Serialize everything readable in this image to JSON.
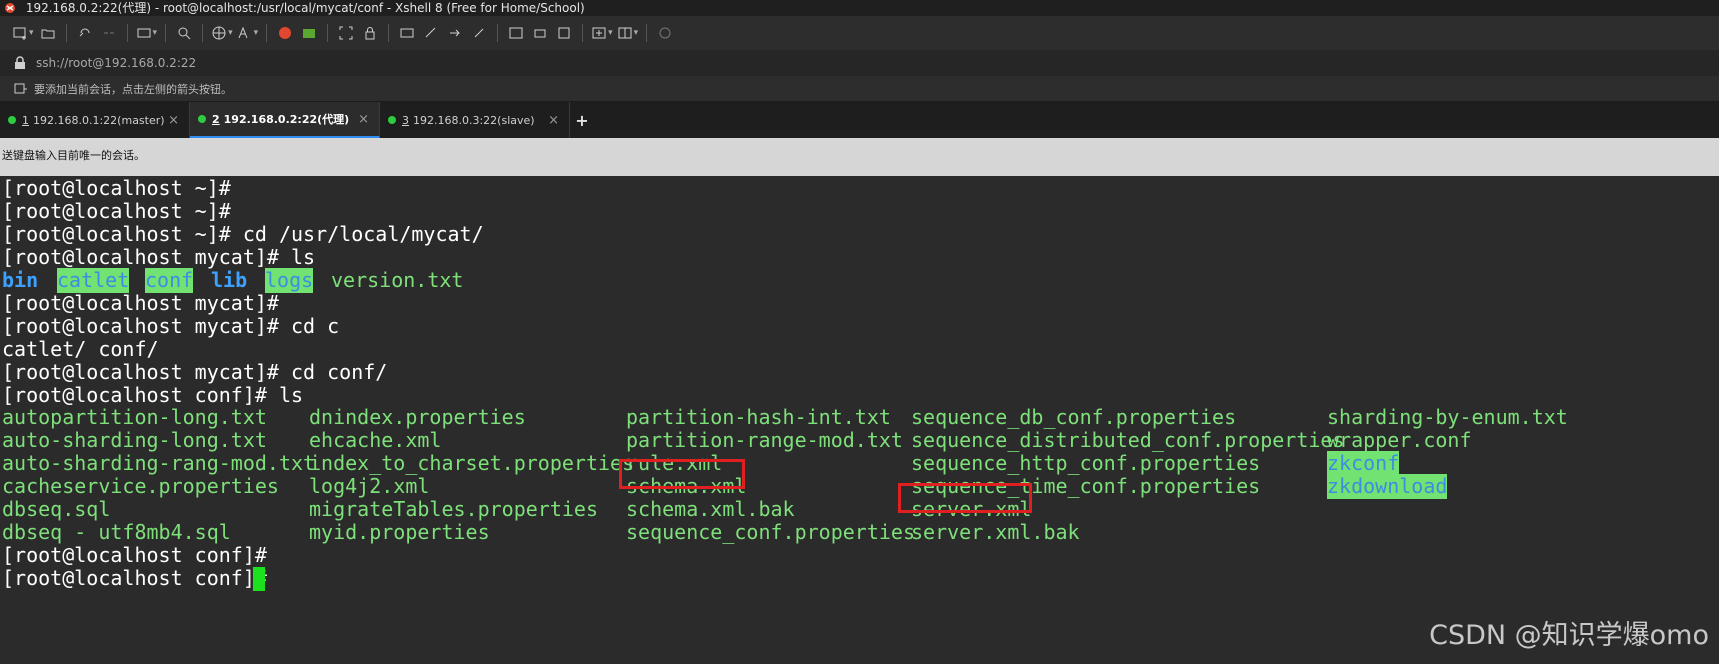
{
  "window": {
    "title": "192.168.0.2:22(代理) - root@localhost:/usr/local/mycat/conf - Xshell 8 (Free for Home/School)"
  },
  "address": {
    "url": "ssh://root@192.168.0.2:22"
  },
  "hint": {
    "text": "要添加当前会话，点击左侧的箭头按钮。"
  },
  "tabs": [
    {
      "num": "1",
      "label": "192.168.0.1:22(master)",
      "active": false
    },
    {
      "num": "2",
      "label": "192.168.0.2:22(代理)",
      "active": true
    },
    {
      "num": "3",
      "label": "192.168.0.3:22(slave)",
      "active": false
    }
  ],
  "tab_close": "×",
  "tab_add": "+",
  "notice": {
    "text": "送键盘输入目前唯一的会话。"
  },
  "terminal": {
    "lines": [
      "[root@localhost ~]#",
      "[root@localhost ~]#",
      "[root@localhost ~]# cd /usr/local/mycat/",
      "[root@localhost mycat]# ls"
    ],
    "ls1": [
      "bin",
      "catlet",
      "conf",
      "lib",
      "logs",
      "version.txt"
    ],
    "lines2": [
      "[root@localhost mycat]#",
      "[root@localhost mycat]# cd c",
      "catlet/ conf/",
      "[root@localhost mycat]# cd conf/",
      "[root@localhost conf]# ls"
    ],
    "files": {
      "col1": [
        "autopartition-long.txt",
        "auto-sharding-long.txt",
        "auto-sharding-rang-mod.txt",
        "cacheservice.properties",
        "dbseq.sql",
        "dbseq - utf8mb4.sql"
      ],
      "col2": [
        "dnindex.properties",
        "ehcache.xml",
        "index_to_charset.properties",
        "log4j2.xml",
        "migrateTables.properties",
        "myid.properties"
      ],
      "col3": [
        "partition-hash-int.txt",
        "partition-range-mod.txt",
        "rule.xml",
        "schema.xml",
        "schema.xml.bak",
        "sequence_conf.properties"
      ],
      "col4": [
        "sequence_db_conf.properties",
        "sequence_distributed_conf.properties",
        "sequence_http_conf.properties",
        "sequence_time_conf.properties",
        "server.xml",
        "server.xml.bak"
      ],
      "col5": [
        "sharding-by-enum.txt",
        "wrapper.conf",
        "zkconf",
        "zkdownload"
      ]
    },
    "lines3": [
      "[root@localhost conf]#",
      "[root@localhost conf]# "
    ]
  },
  "colors": {
    "file_green": "#7ee07a",
    "dir_blue": "#3da2ff",
    "dir_highlight": "#72e272",
    "highlight_box": "#e02020",
    "cursor": "#1ee11e"
  },
  "watermark": {
    "text": "CSDN @知识学爆omo"
  }
}
